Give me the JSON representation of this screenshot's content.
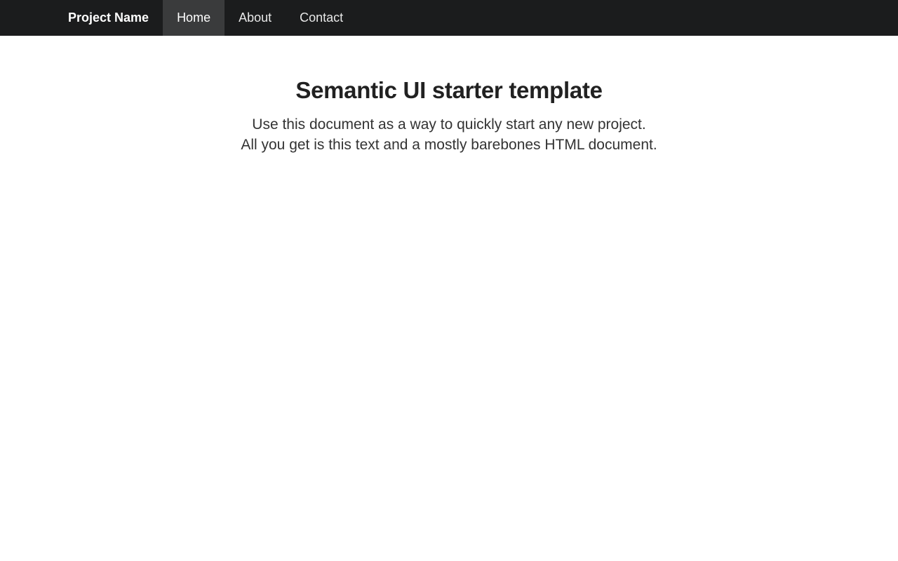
{
  "navbar": {
    "brand": "Project Name",
    "items": [
      {
        "label": "Home",
        "active": true
      },
      {
        "label": "About",
        "active": false
      },
      {
        "label": "Contact",
        "active": false
      }
    ]
  },
  "main": {
    "title": "Semantic UI starter template",
    "lines": [
      "Use this document as a way to quickly start any new project.",
      "All you get is this text and a mostly barebones HTML document."
    ]
  },
  "colors": {
    "navbar_bg": "#1b1c1d",
    "active_item_bg": "#3a3b3c",
    "page_bg": "#ffffff"
  }
}
